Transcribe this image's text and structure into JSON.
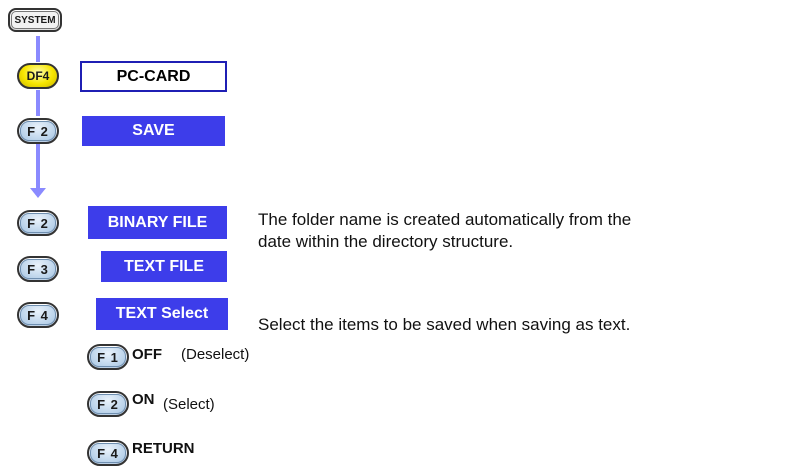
{
  "keys": {
    "system": "SYSTEM",
    "df4": "DF4",
    "f2_save": "F 2",
    "f2_binary": "F 2",
    "f3_text": "F 3",
    "f4_textselect": "F 4",
    "f1_off": "F 1",
    "f2_on": "F 2",
    "f4_return": "F 4"
  },
  "buttons": {
    "pc_card": "PC-CARD",
    "save": "SAVE",
    "binary_file": "BINARY FILE",
    "text_file": "TEXT FILE",
    "text_select": "TEXT Select"
  },
  "descriptions": {
    "folder_line1": "The folder name is created automatically from the",
    "folder_line2": "date within the directory structure.",
    "text_select": "Select the items to be saved when saving as text."
  },
  "submenu": {
    "off_label": "OFF",
    "off_note": "(Deselect)",
    "on_label": "ON",
    "on_note": "(Select)",
    "return_label": "RETURN"
  },
  "colors": {
    "button_blue": "#3d3dea",
    "arrow": "#8a8aff",
    "df_key_yellow": "#f7e600"
  }
}
